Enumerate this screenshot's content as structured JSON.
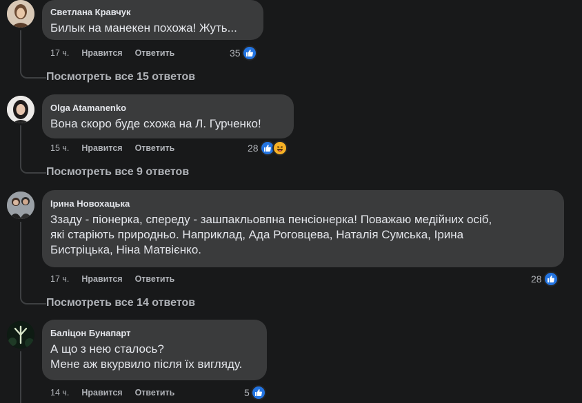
{
  "comments": [
    {
      "author": "Светлана Кравчук",
      "lines": [
        "Билык на манекен похожа! Жуть..."
      ],
      "time": "17 ч.",
      "like_label": "Нравится",
      "reply_label": "Ответить",
      "reaction_count": "35",
      "reactions": [
        "like"
      ],
      "view_replies": "Посмотреть все 15 ответов"
    },
    {
      "author": "Olga Atamanenko",
      "lines": [
        "Вона скоро буде схожа на Л. Гурченко!"
      ],
      "time": "15 ч.",
      "like_label": "Нравится",
      "reply_label": "Ответить",
      "reaction_count": "28",
      "reactions": [
        "like",
        "haha"
      ],
      "view_replies": "Посмотреть все 9 ответов"
    },
    {
      "author": "Ірина Новохацька",
      "lines": [
        "Ззаду - піонерка, спереду - зашпакльовпна пенсіонерка! Поважаю медійних осіб,",
        "які старіють природньо. Наприклад, Ада Роговцева, Наталія Сумська, Ірина",
        "Бистріцька, Ніна Матвієнко."
      ],
      "time": "17 ч.",
      "like_label": "Нравится",
      "reply_label": "Ответить",
      "reaction_count": "28",
      "reactions": [
        "like"
      ],
      "view_replies": "Посмотреть все 14 ответов"
    },
    {
      "author": "Баліцон Бунапарт",
      "lines": [
        "А що з нею сталось?",
        "Мене аж вкурвило після їх вигляду."
      ],
      "time": "14 ч.",
      "like_label": "Нравится",
      "reply_label": "Ответить",
      "reaction_count": "5",
      "reactions": [
        "like"
      ]
    }
  ],
  "colors": {
    "background": "#18191a",
    "bubble": "#3a3b3c",
    "text": "#e4e6eb",
    "secondary_text": "#b0b3b8",
    "like_blue": "#2374e1",
    "haha_yellow": "#f7b125"
  }
}
